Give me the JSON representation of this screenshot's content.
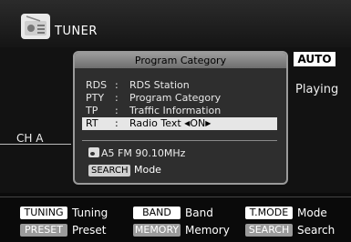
{
  "header": {
    "title": "TUNER",
    "icon": "radio-icon"
  },
  "status": {
    "auto": "AUTO",
    "playing": "Playing",
    "channel": "CH A"
  },
  "dialog": {
    "title": "Program Category",
    "items": [
      {
        "key": "RDS",
        "sep": ":",
        "value": "RDS Station"
      },
      {
        "key": "PTY",
        "sep": ":",
        "value": "Program Category"
      },
      {
        "key": "TP",
        "sep": ":",
        "value": "Traffic Information"
      },
      {
        "key": "RT",
        "sep": ":",
        "value": "Radio Text",
        "option": "ON",
        "selected": true
      }
    ],
    "station": "A5 FM 90.10MHz",
    "search_key": "SEARCH",
    "search_label": "Mode"
  },
  "footer": {
    "row1": [
      {
        "key": "TUNING",
        "label": "Tuning"
      },
      {
        "key": "BAND",
        "label": "Band"
      },
      {
        "key": "T.MODE",
        "label": "Mode"
      }
    ],
    "row2": [
      {
        "key": "PRESET",
        "label": "Preset"
      },
      {
        "key": "MEMORY",
        "label": "Memory"
      },
      {
        "key": "SEARCH",
        "label": "Search"
      }
    ]
  },
  "colors": {
    "background": "#0b0b0b",
    "dialog_bg": "#2e2e2e",
    "header_gray": "#8a8a8a",
    "selected_row": "#e6e6e6"
  }
}
